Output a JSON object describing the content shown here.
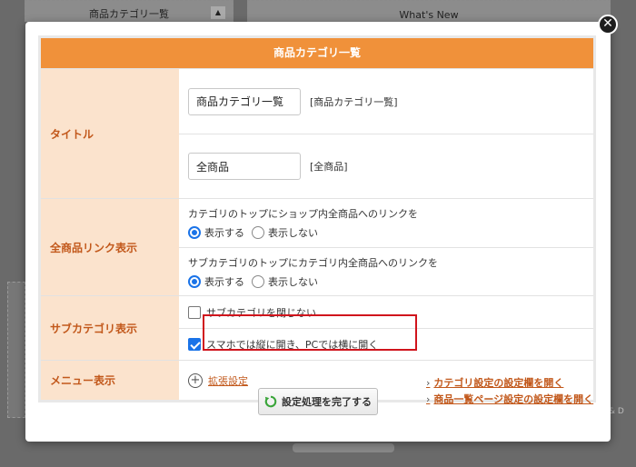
{
  "background": {
    "tab_left_label": "商品カテゴリ一覧",
    "tab_right_label": "What's New",
    "tab_left_arrow": "▲",
    "side_fragment": "& D"
  },
  "modal": {
    "close_glyph": "✕",
    "header": "商品カテゴリ一覧",
    "title_label": "タイトル",
    "title_input_1": "商品カテゴリ一覧",
    "title_bracket_1": "[商品カテゴリ一覧]",
    "title_input_2": "全商品",
    "title_bracket_2": "[全商品]",
    "all_link_label": "全商品リンク表示",
    "all_link_opt1_title": "カテゴリのトップにショップ内全商品へのリンクを",
    "all_link_opt2_title": "サブカテゴリのトップにカテゴリ内全商品へのリンクを",
    "radio_show": "表示する",
    "radio_hide": "表示しない",
    "subcat_label": "サブカテゴリ表示",
    "subcat_cb1": "サブカテゴリを閉じない",
    "subcat_cb2": "スマホでは縦に開き、PCでは横に開く",
    "menu_label": "メニュー表示",
    "menu_ext_link": "拡張設定",
    "complete_button": "設定処理を完了する",
    "link_category": "カテゴリ設定の設定欄を開く",
    "link_product_list": "商品一覧ページ設定の設定欄を開く",
    "chevron": "›",
    "plus": "+"
  },
  "states": {
    "opt1_selected": "表示する",
    "opt2_selected": "表示する",
    "subcat_cb1_checked": false,
    "subcat_cb2_checked": true
  },
  "colors": {
    "header_orange": "#f0913a",
    "label_bg": "#fbe3cd",
    "label_text": "#c2581b",
    "highlight_red": "#d0141c",
    "radio_blue": "#1a73e8"
  }
}
